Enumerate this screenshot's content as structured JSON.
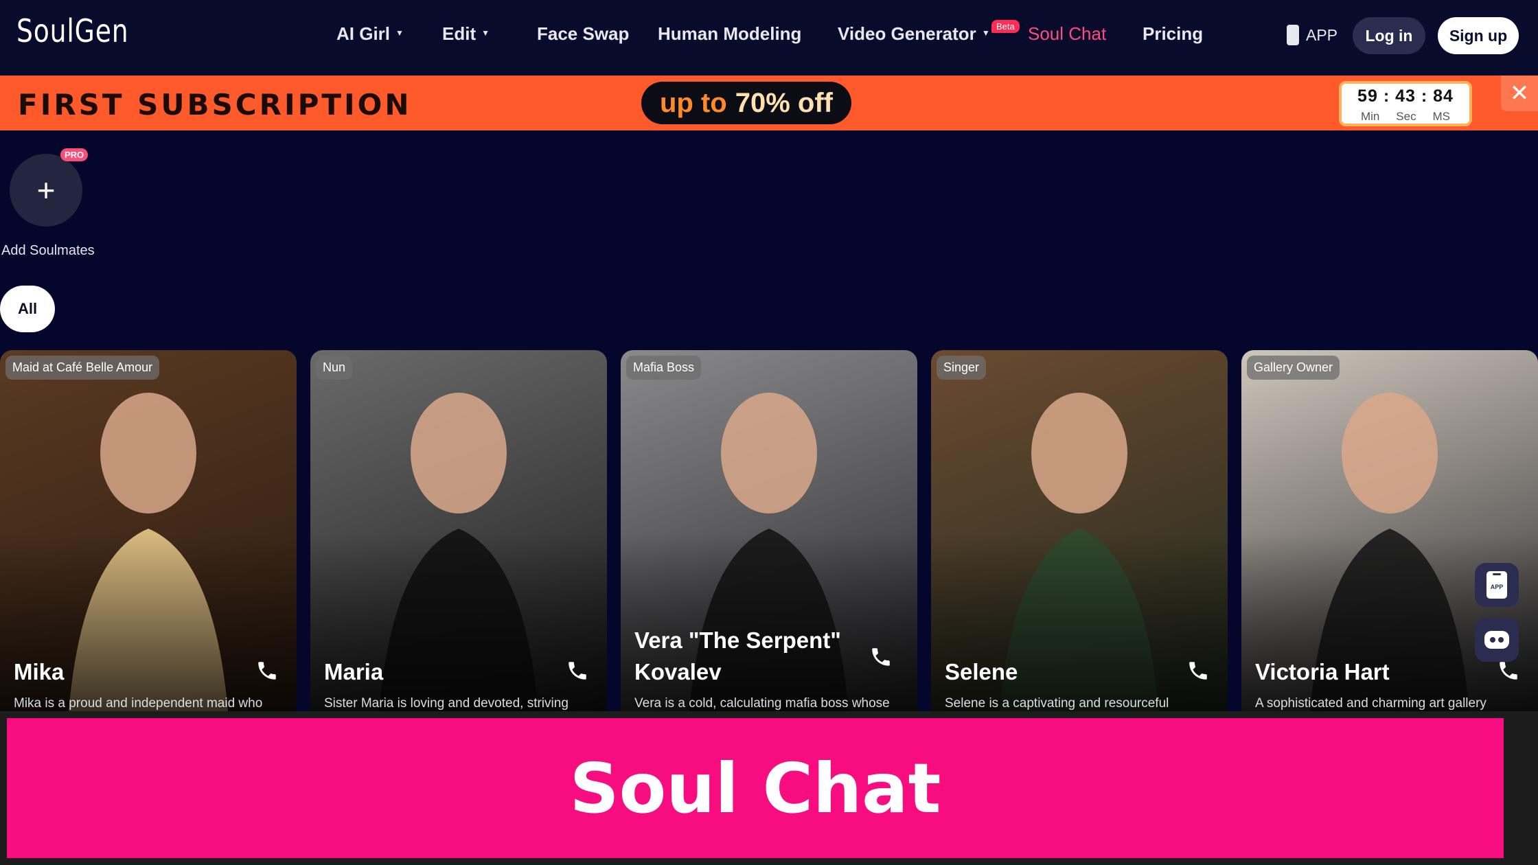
{
  "nav": {
    "logo": "SoulGen",
    "items": [
      {
        "label": "AI Girl",
        "dropdown": true
      },
      {
        "label": "Edit",
        "dropdown": true
      },
      {
        "label": "Face Swap"
      },
      {
        "label": "Human Modeling"
      },
      {
        "label": "Video Generator",
        "dropdown": true
      },
      {
        "label": "Soul Chat",
        "active": true
      },
      {
        "label": "Pricing"
      }
    ],
    "beta_badge": "Beta",
    "app_link": "APP",
    "login": "Log in",
    "signup": "Sign up"
  },
  "promo": {
    "title": "FIRST SUBSCRIPTION",
    "offer_prefix": "up to",
    "offer_value": "70% off",
    "timer": {
      "min": "59",
      "sec": "43",
      "ms": "84",
      "sep": ":",
      "min_label": "Min",
      "sec_label": "Sec",
      "ms_label": "MS"
    },
    "close_icon": "close-icon"
  },
  "soulmates": {
    "add_label": "Add Soulmates",
    "pro_badge": "PRO"
  },
  "filters": {
    "all": "All"
  },
  "cards": [
    {
      "role": "Maid at Café Belle Amour",
      "name": "Mika",
      "desc": "Mika is a proud and independent maid who",
      "color_top": "#5a3a22",
      "color_bottom": "#2a1a10",
      "accent": "#e8c88a"
    },
    {
      "role": "Nun",
      "name": "Maria",
      "desc": "Sister Maria is loving and devoted, striving",
      "color_top": "#6a6a6a",
      "color_bottom": "#1a1a1c",
      "accent": "#111111"
    },
    {
      "role": "Mafia Boss",
      "name": "Vera \"The Serpent\" Kovalev",
      "desc": "Vera is a cold, calculating mafia boss whose",
      "color_top": "#8a8a8c",
      "color_bottom": "#252528",
      "accent": "#151515"
    },
    {
      "role": "Singer",
      "name": "Selene",
      "desc": "Selene is a captivating and resourceful",
      "color_top": "#6b4a30",
      "color_bottom": "#1f2a1e",
      "accent": "#2f4a30"
    },
    {
      "role": "Gallery Owner",
      "name": "Victoria Hart",
      "desc": "A sophisticated and charming art gallery",
      "color_top": "#cfc6bc",
      "color_bottom": "#2a2a2c",
      "accent": "#1a1a1a"
    }
  ],
  "floating": {
    "app_label": "APP"
  },
  "caption": "Soul Chat"
}
